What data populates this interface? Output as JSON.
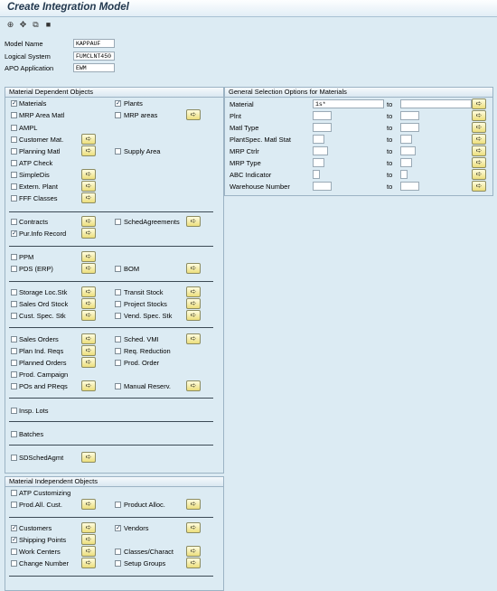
{
  "window": {
    "title": "Create Integration Model"
  },
  "toolbar": {
    "icons": [
      "execute-icon",
      "hierarchy-icon",
      "copy-icon",
      "save-icon"
    ],
    "glyphs": [
      "⊕",
      "✥",
      "⧉",
      "■"
    ]
  },
  "header_fields": [
    {
      "label": "Model Name",
      "value": "KAPPAUF"
    },
    {
      "label": "Logical System",
      "value": "FUMCLNT450"
    },
    {
      "label": "APO Application",
      "value": "EWM"
    }
  ],
  "mdo": {
    "title": "Material Dependent Objects",
    "items": [
      {
        "label": "Materials",
        "checked": true
      },
      {
        "label": "Plants",
        "checked": true
      },
      {
        "label": "MRP Area Matl",
        "checked": false
      },
      {
        "label": "MRP areas",
        "checked": false
      },
      {
        "label": "AMPL",
        "checked": false
      },
      {
        "label": "Customer Mat.",
        "checked": false
      },
      {
        "label": "Planning Matl",
        "checked": false
      },
      {
        "label": "Supply Area",
        "checked": false
      },
      {
        "label": "ATP Check",
        "checked": false
      },
      {
        "label": "SimpleDis",
        "checked": false
      },
      {
        "label": "Extern. Plant",
        "checked": false
      },
      {
        "label": "FFF Classes",
        "checked": false
      },
      {
        "label": "Contracts",
        "checked": false
      },
      {
        "label": "SchedAgreements",
        "checked": false
      },
      {
        "label": "Pur.Info Record",
        "checked": true
      },
      {
        "label": "PPM",
        "checked": false
      },
      {
        "label": "PDS (ERP)",
        "checked": false
      },
      {
        "label": "BOM",
        "checked": false
      },
      {
        "label": "Storage Loc.Stk",
        "checked": false
      },
      {
        "label": "Transit Stock",
        "checked": false
      },
      {
        "label": "Sales Ord Stock",
        "checked": false
      },
      {
        "label": "Project Stocks",
        "checked": false
      },
      {
        "label": "Cust. Spec. Stk",
        "checked": false
      },
      {
        "label": "Vend. Spec. Stk",
        "checked": false
      },
      {
        "label": "Sales Orders",
        "checked": false
      },
      {
        "label": "Sched. VMI",
        "checked": false
      },
      {
        "label": "Plan Ind. Reqs",
        "checked": false
      },
      {
        "label": "Req. Reduction",
        "checked": false
      },
      {
        "label": "Planned Orders",
        "checked": false
      },
      {
        "label": "Prod. Order",
        "checked": false
      },
      {
        "label": "Prod. Campaign",
        "checked": false
      },
      {
        "label": "POs and PReqs",
        "checked": false
      },
      {
        "label": "Manual Reserv.",
        "checked": false
      },
      {
        "label": "Insp. Lots",
        "checked": false
      },
      {
        "label": "Batches",
        "checked": false
      },
      {
        "label": "SDSchedAgmt",
        "checked": false
      }
    ]
  },
  "gso": {
    "title": "General Selection Options for Materials",
    "to_label": "to",
    "rows": [
      {
        "label": "Material",
        "from": "1s*",
        "to": ""
      },
      {
        "label": "Plnt",
        "from": "",
        "to": ""
      },
      {
        "label": "Matl Type",
        "from": "",
        "to": ""
      },
      {
        "label": "PlantSpec. Matl Stat",
        "from": "",
        "to": ""
      },
      {
        "label": "MRP Ctrlr",
        "from": "",
        "to": ""
      },
      {
        "label": "MRP Type",
        "from": "",
        "to": ""
      },
      {
        "label": "ABC Indicator",
        "from": "",
        "to": ""
      },
      {
        "label": "Warehouse Number",
        "from": "",
        "to": ""
      }
    ]
  },
  "mio": {
    "title": "Material Independent Objects",
    "items": [
      {
        "label": "ATP Customizing",
        "checked": false
      },
      {
        "label": "Prod.All. Cust.",
        "checked": false
      },
      {
        "label": "Product Alloc.",
        "checked": false
      },
      {
        "label": "Customers",
        "checked": true
      },
      {
        "label": "Vendors",
        "checked": true
      },
      {
        "label": "Shipping Points",
        "checked": true
      },
      {
        "label": "Work Centers",
        "checked": false
      },
      {
        "label": "Classes/Charact",
        "checked": false
      },
      {
        "label": "Change Number",
        "checked": false
      },
      {
        "label": "Setup Groups",
        "checked": false
      }
    ]
  },
  "glyphs": {
    "check": "✓",
    "arrow": "➪"
  }
}
